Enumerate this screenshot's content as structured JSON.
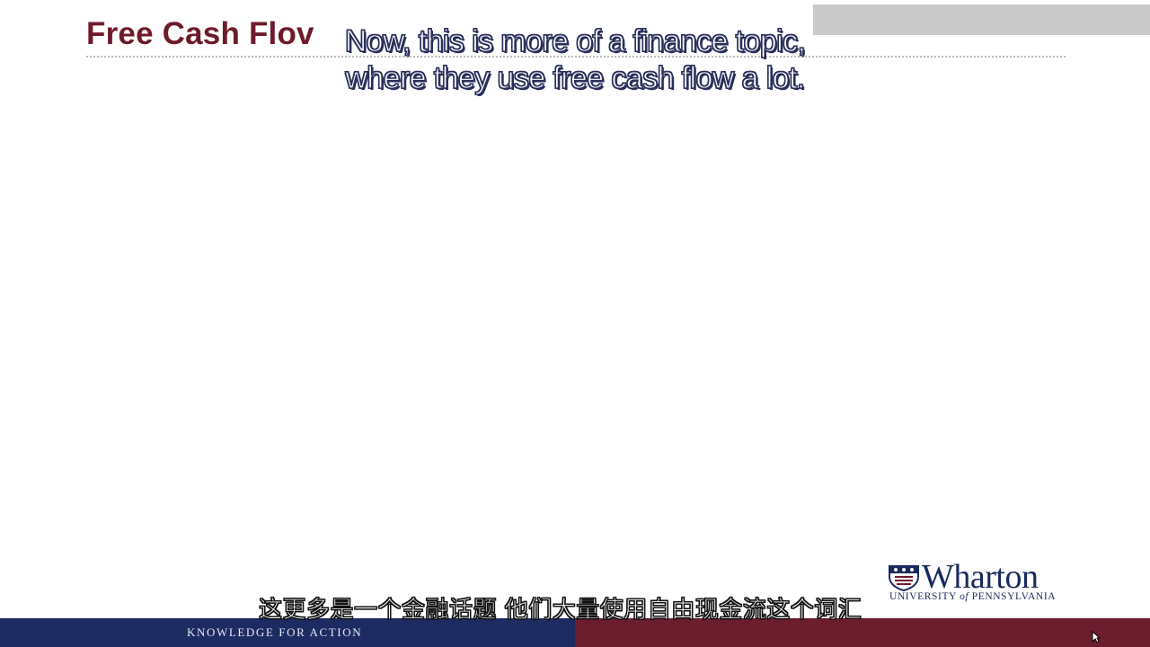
{
  "slide": {
    "title": "Free Cash Flov",
    "footer_text": "KNOWLEDGE FOR ACTION"
  },
  "subtitles": {
    "english_lines": [
      "Now, this is more of a finance topic,",
      "where they use free cash flow a lot."
    ],
    "chinese": "这更多是一个金融话题 他们大量使用自由现金流这个词汇"
  },
  "logo": {
    "name": "Wharton",
    "subtitle_prefix": "UNIVERSITY",
    "subtitle_of": "of",
    "subtitle_suffix": "PENNSYLVANIA"
  },
  "colors": {
    "title": "#6e1a2a",
    "footer_blue": "#1d2b63",
    "footer_maroon": "#6b1d2e",
    "logo_navy": "#1a2a5e"
  },
  "icons": {
    "crest": "penn-shield-icon",
    "cursor": "mouse-pointer-icon"
  }
}
